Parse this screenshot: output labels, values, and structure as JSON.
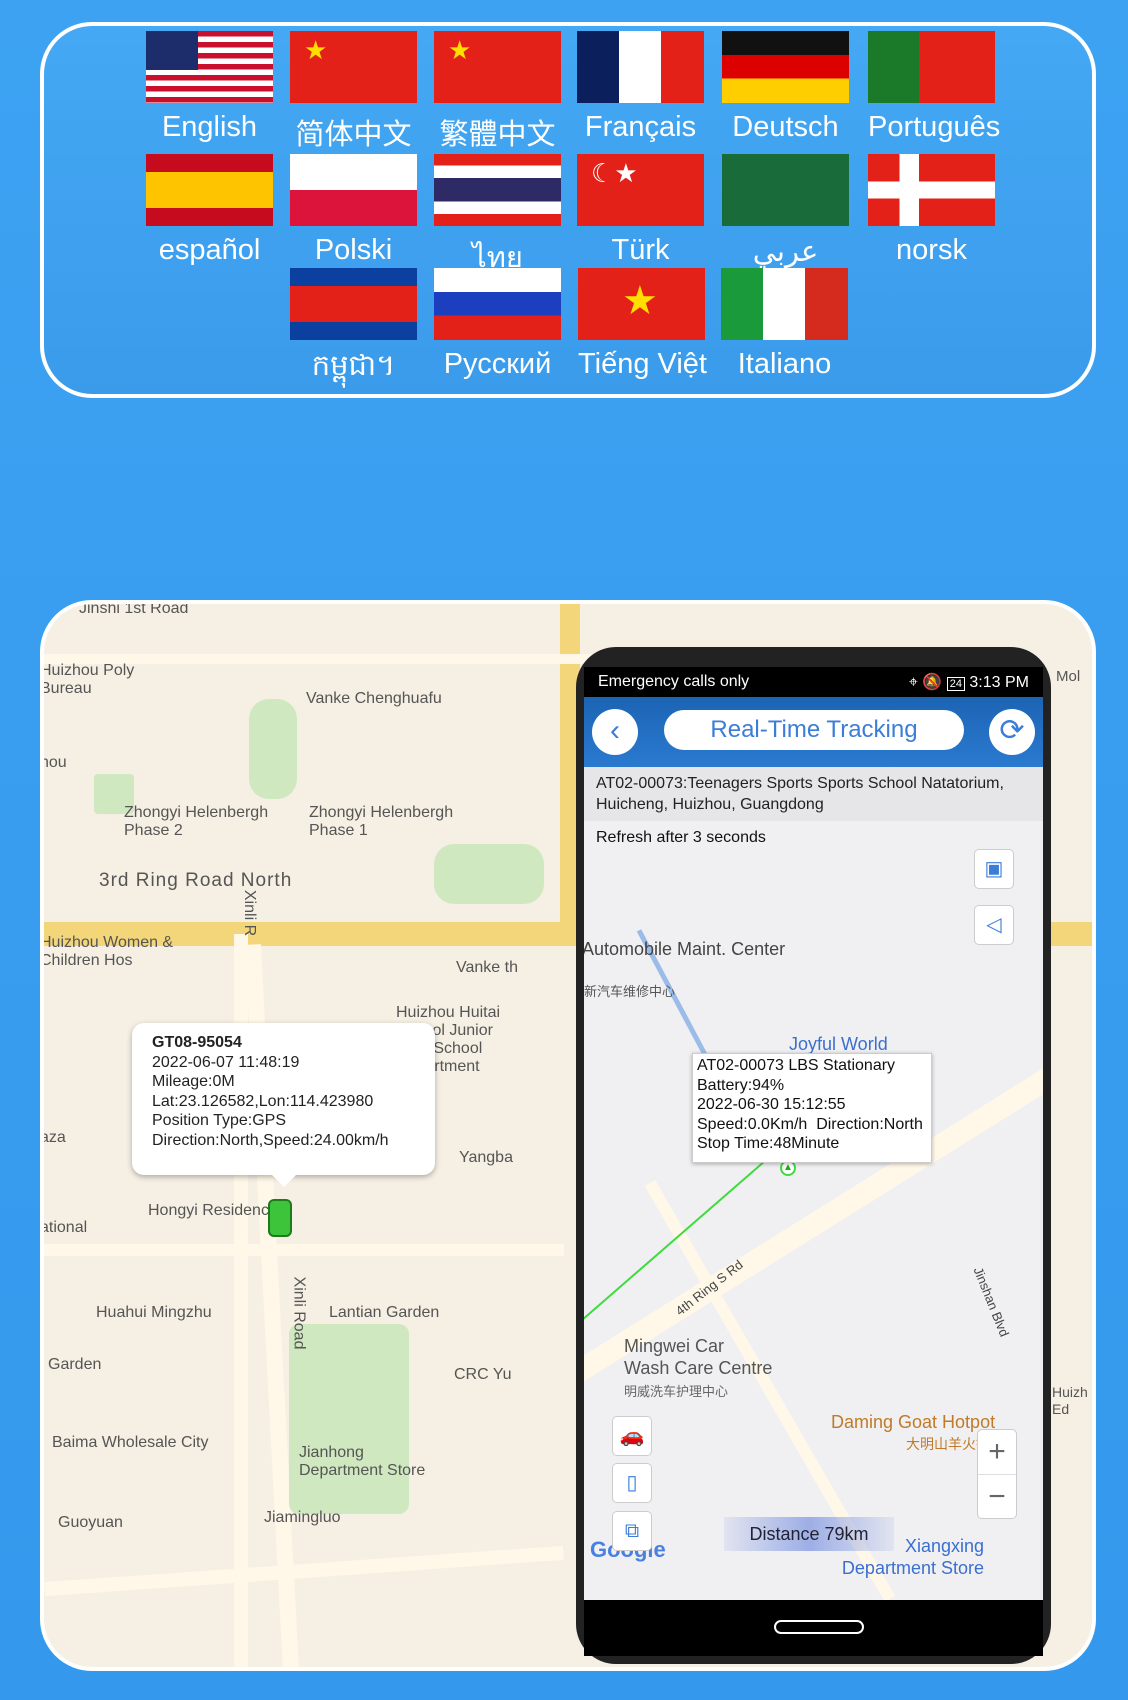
{
  "languages": [
    {
      "label": "English",
      "flag": "us"
    },
    {
      "label": "简体中文",
      "flag": "cn"
    },
    {
      "label": "繁體中文",
      "flag": "cn"
    },
    {
      "label": "Français",
      "flag": "fr"
    },
    {
      "label": "Deutsch",
      "flag": "de"
    },
    {
      "label": "Português",
      "flag": "pt"
    },
    {
      "label": "español",
      "flag": "es"
    },
    {
      "label": "Polski",
      "flag": "pl"
    },
    {
      "label": "ไทย",
      "flag": "th"
    },
    {
      "label": "Türk",
      "flag": "tr"
    },
    {
      "label": "عربي",
      "flag": "sa"
    },
    {
      "label": "norsk",
      "flag": "no"
    },
    {
      "label": "កម្ពុជា។",
      "flag": "kh"
    },
    {
      "label": "Русский",
      "flag": "ru"
    },
    {
      "label": "Tiếng Việt",
      "flag": "vn"
    },
    {
      "label": "Italiano",
      "flag": "it"
    }
  ],
  "left_map": {
    "labels": [
      "Jinshi 1st Road",
      "Huizhou Poly Bureau",
      "Vanke Chenghuafu",
      "Zhongyi Helenbergh Phase 2",
      "Zhongyi Helenbergh Phase 1",
      "3rd Ring Road North",
      "Xinli R",
      "Huizhou Women & Children Hos",
      "Vanke th",
      "Huizhou Huitai School Junior High School Department",
      "Hongyi Residence 2",
      "Yangba",
      "Hongyi Residence",
      "Huahui Mingzhu",
      "Lantian Garden",
      "Xinli Road",
      "Garden",
      "CRC Yu",
      "Baima Wholesale City",
      "Jianhong Department Store",
      "Jiamingluo",
      "Guoyuan",
      "aza",
      "ational",
      "hou"
    ],
    "popup": {
      "device": "GT08-95054",
      "time": "2022-06-07 11:48:19",
      "mileage": "Mileage:0M",
      "latlon": "Lat:23.126582,Lon:114.423980",
      "position_type": "Position Type:GPS",
      "direction_speed": "Direction:North,Speed:24.00km/h"
    }
  },
  "phone": {
    "status": {
      "left": "Emergency calls only",
      "battery": "24",
      "time": "3:13 PM"
    },
    "header": {
      "title": "Real-Time Tracking"
    },
    "address": "AT02-00073:Teenagers Sports Sports School Natatorium, Huicheng, Huizhou, Guangdong",
    "refresh": "Refresh after 3 seconds",
    "map_labels": {
      "automobile": "Automobile Maint. Center",
      "automobile_cn": "新汽车维修中心",
      "joyful": "Joyful World",
      "ring": "4th Ring S Rd",
      "mingwei": "Mingwei Car Wash Care Centre",
      "mingwei_cn": "明威洗车护理中心",
      "jinshan": "Jinshan Blvd",
      "daming": "Daming Goat Hotpot",
      "daming_cn": "大明山羊火锅",
      "xiangxing": "Xiangxing Department Store",
      "google": "Google",
      "mol": "Mol",
      "huizh": "Huizh Ed"
    },
    "popup": {
      "line1": "AT02-00073 LBS Stationary",
      "battery": "Battery:94%",
      "time": "2022-06-30 15:12:55",
      "speed_dir": "Speed:0.0Km/h  Direction:North",
      "stop": "Stop Time:48Minute"
    },
    "distance": "Distance 79km",
    "zoom_in": "+",
    "zoom_out": "−"
  }
}
